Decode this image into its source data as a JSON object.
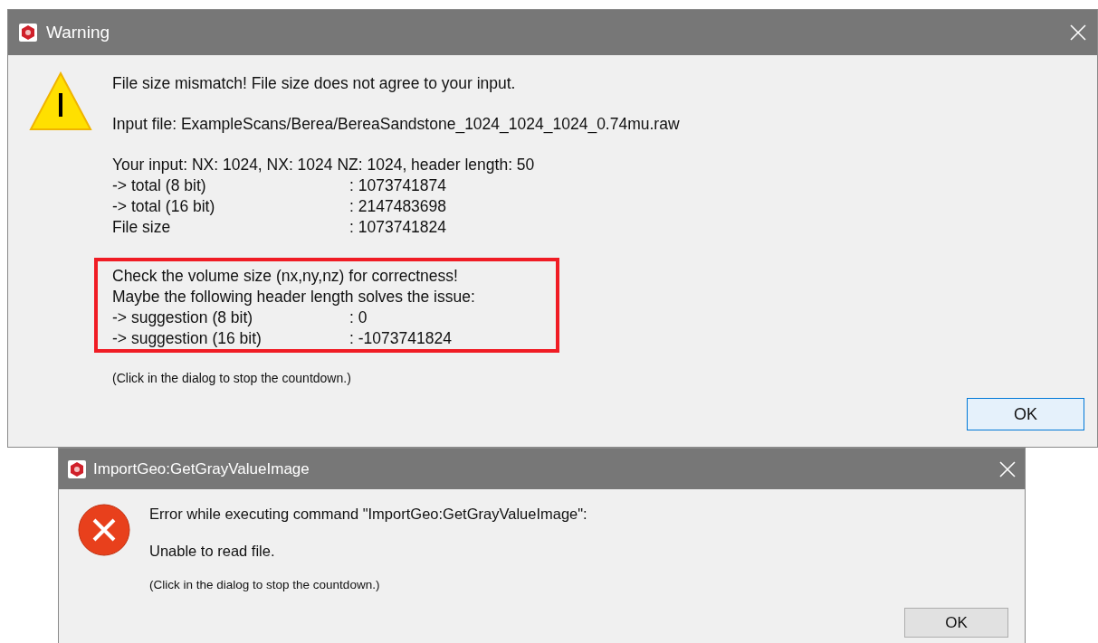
{
  "warning_dialog": {
    "title": "Warning",
    "heading": "File size mismatch! File size does not agree to your input.",
    "input_file": "Input file: ExampleScans/Berea/BereaSandstone_1024_1024_1024_0.74mu.raw",
    "your_input": "Your input: NX: 1024, NX: 1024 NZ: 1024, header length: 50",
    "totals": [
      {
        "label": "-> total (8 bit)",
        "value": ": 1073741874"
      },
      {
        "label": "-> total (16 bit)",
        "value": ": 2147483698"
      },
      {
        "label": "File size",
        "value": ": 1073741824"
      }
    ],
    "highlight": {
      "lines": [
        "Check the volume size (nx,ny,nz) for correctness!",
        "Maybe the following header length solves the issue:"
      ],
      "suggestions": [
        {
          "label": "-> suggestion (8 bit)",
          "value": ": 0"
        },
        {
          "label": "-> suggestion (16 bit)",
          "value": ": -1073741824"
        }
      ]
    },
    "countdown_note": "(Click in the dialog to stop the countdown.)",
    "button": "OK"
  },
  "error_dialog": {
    "title": "ImportGeo:GetGrayValueImage",
    "message": "Error while executing command \"ImportGeo:GetGrayValueImage\":",
    "detail": "Unable to read file.",
    "countdown_note": "(Click in the dialog to stop the countdown.)",
    "button": "OK"
  }
}
